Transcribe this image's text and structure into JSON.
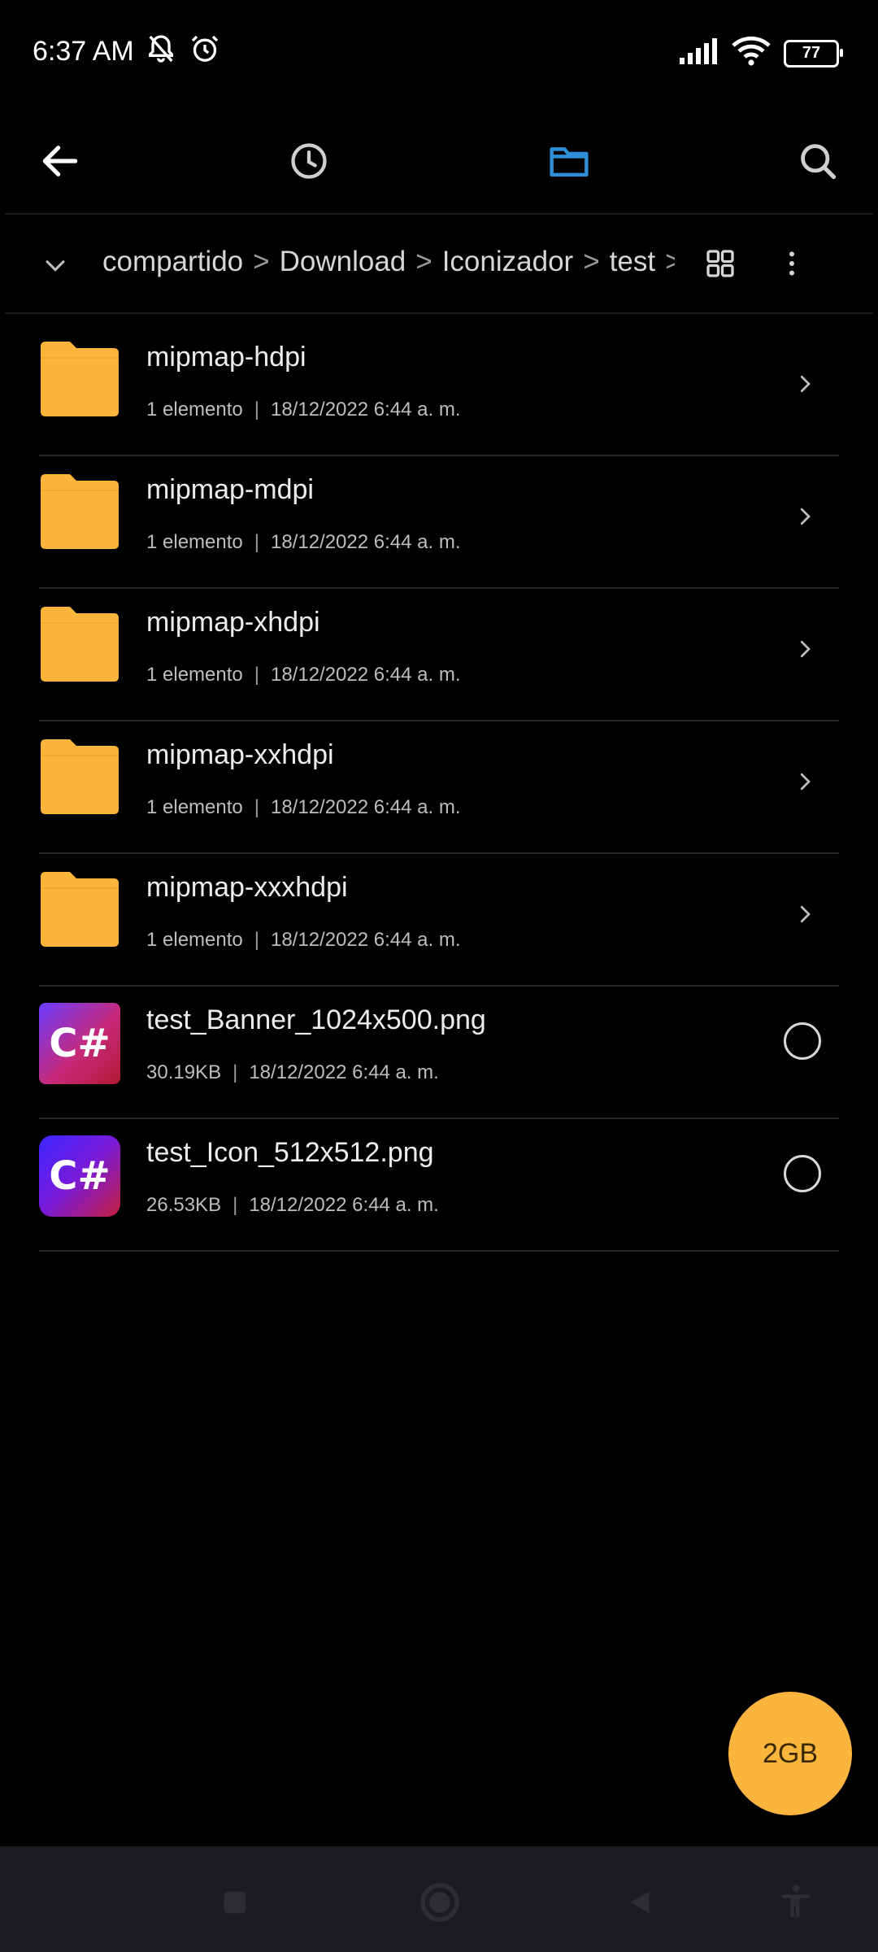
{
  "status_bar": {
    "time": "6:37 AM",
    "battery": "77"
  },
  "breadcrumb": {
    "segments": [
      "compartido",
      "Download",
      "Iconizador",
      "test"
    ]
  },
  "files": [
    {
      "name": "mipmap-hdpi",
      "size": "1 elemento",
      "date": "18/12/2022 6:44 a. m."
    },
    {
      "name": "mipmap-mdpi",
      "size": "1 elemento",
      "date": "18/12/2022 6:44 a. m."
    },
    {
      "name": "mipmap-xhdpi",
      "size": "1 elemento",
      "date": "18/12/2022 6:44 a. m."
    },
    {
      "name": "mipmap-xxhdpi",
      "size": "1 elemento",
      "date": "18/12/2022 6:44 a. m."
    },
    {
      "name": "mipmap-xxxhdpi",
      "size": "1 elemento",
      "date": "18/12/2022 6:44 a. m."
    },
    {
      "name": "test_Banner_1024x500.png",
      "size": "30.19KB",
      "date": "18/12/2022 6:44 a. m.",
      "thumb_text": "C#"
    },
    {
      "name": "test_Icon_512x512.png",
      "size": "26.53KB",
      "date": "18/12/2022 6:44 a. m.",
      "thumb_text": "C#"
    }
  ],
  "fab": {
    "label": "2GB"
  },
  "colors": {
    "accent": "#2d8fd5",
    "folder": "#fbb53c",
    "fab": "#fbb53c",
    "background": "#000000"
  }
}
